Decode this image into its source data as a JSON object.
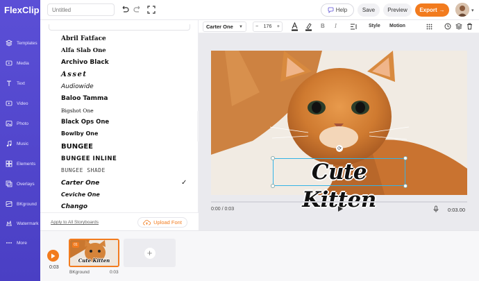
{
  "app": {
    "logo": "FlexClip"
  },
  "sidebar": {
    "items": [
      {
        "label": "Templates",
        "icon": "layers-icon"
      },
      {
        "label": "Media",
        "icon": "media-icon"
      },
      {
        "label": "Text",
        "icon": "text-icon"
      },
      {
        "label": "Video",
        "icon": "video-icon"
      },
      {
        "label": "Photo",
        "icon": "photo-icon"
      },
      {
        "label": "Music",
        "icon": "music-icon"
      },
      {
        "label": "Elements",
        "icon": "elements-icon"
      },
      {
        "label": "Overlays",
        "icon": "overlays-icon"
      },
      {
        "label": "BKground",
        "icon": "background-icon"
      },
      {
        "label": "Watermark",
        "icon": "watermark-icon"
      },
      {
        "label": "More",
        "icon": "more-icon"
      }
    ]
  },
  "topbar": {
    "title_placeholder": "Untitled",
    "help_label": "Help",
    "save_label": "Save",
    "preview_label": "Preview",
    "export_label": "Export"
  },
  "font_panel": {
    "fonts": [
      "Abril Fatface",
      "Alfa Slab One",
      "Archivo Black",
      "Asset",
      "Audiowide",
      "Baloo Tamma",
      "Bigshot One",
      "Black Ops One",
      "Bowlby One",
      "BUNGEE",
      "BUNGEE INLINE",
      "BUNGEE SHADE",
      "Carter One",
      "Ceviche One",
      "Chango"
    ],
    "selected_font": "Carter One",
    "apply_all_label": "Apply to All Storyboards",
    "upload_label": "Upload Font"
  },
  "text_toolbar": {
    "font_value": "Carter One",
    "size_value": "176",
    "minus": "−",
    "plus": "+",
    "style_label": "Style",
    "motion_label": "Motion"
  },
  "canvas": {
    "caption": "Cute Kitten",
    "time_current": "0:00 / 0:03",
    "time_total": "0:03.00"
  },
  "timeline": {
    "time": "0:03",
    "clip_number": "01",
    "clip_caption": "Cute Kitten",
    "clip_label": "BKground",
    "clip_duration": "0:03"
  },
  "colors": {
    "sidebar": "#5b4fd6",
    "accent": "#f27b1e",
    "selection": "#33b3e6"
  }
}
